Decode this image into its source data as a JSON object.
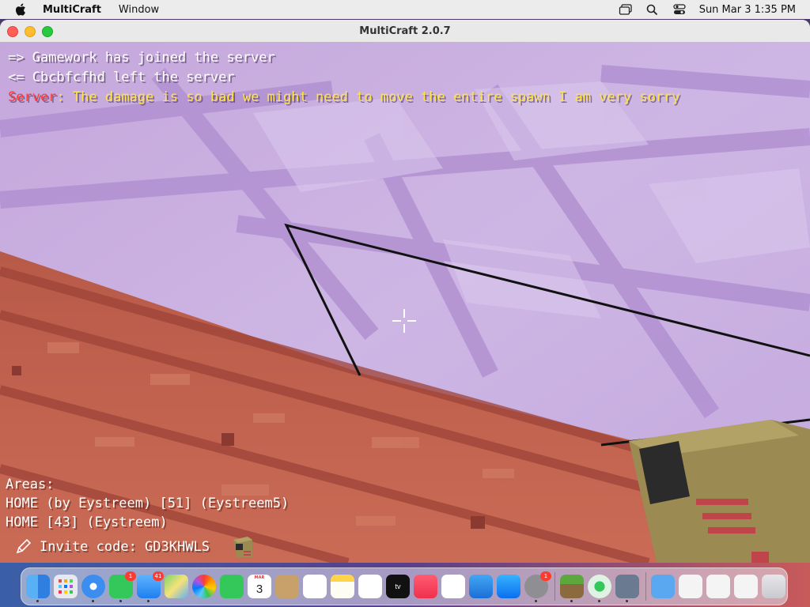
{
  "menubar": {
    "app_name": "MultiCraft",
    "menus": [
      "Window"
    ],
    "clock": "Sun Mar 3  1:35 PM"
  },
  "window": {
    "title": "MultiCraft 2.0.7"
  },
  "chat": {
    "line1": "=> Gamework has joined the server",
    "line2": "<= Cbcbfcfhd left the server",
    "server_name": "Server",
    "server_sep": ": ",
    "server_msg": "The damage is so bad we might need to move the entire spawn I am very sorry"
  },
  "areas": {
    "header": "Areas:",
    "entries": [
      "HOME (by Eystreem) [51] (Eystreem5)",
      "HOME [43] (Eystreem)"
    ]
  },
  "invite": {
    "text": "Invite code: GD3KHWLS"
  },
  "dock": {
    "calendar_month": "MAR",
    "calendar_day": "3",
    "tv_label": "tv",
    "badges": {
      "messages": "1",
      "mail": "41",
      "settings": "1"
    }
  },
  "colors": {
    "wall": "#c9b1e0",
    "floor": "#c0624d",
    "server_name": "#ff3a3a",
    "server_msg": "#ffe34a"
  }
}
